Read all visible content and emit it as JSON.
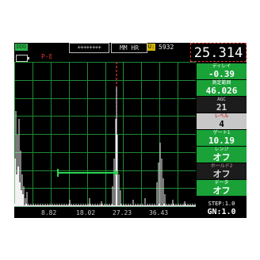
{
  "status_bar": {
    "channel_badge": "DDD",
    "crosses": "++++++++",
    "mode": "MM HR",
    "u_label": "U:",
    "u_value": "5932",
    "reading": "25.314"
  },
  "indicator": {
    "pe_label": "P-E"
  },
  "params": [
    {
      "label": "ディレイ",
      "value": "-0.39",
      "style": "green"
    },
    {
      "label": "測定範囲",
      "value": "46.026",
      "style": "green"
    },
    {
      "label": "AGC",
      "value": "21",
      "style": "dark"
    },
    {
      "label": "レベル",
      "value": "4",
      "style": "grey"
    },
    {
      "label": "ゲート1",
      "value": "10.19",
      "style": "green"
    },
    {
      "label": "レンジ",
      "value": "オフ",
      "style": "green"
    },
    {
      "label": "ホールド2",
      "value": "オフ",
      "style": "dark"
    },
    {
      "label": "データ",
      "value": "オフ",
      "style": "green"
    }
  ],
  "step": {
    "line1": "STEP:1.0",
    "line2": "GN:1.0"
  },
  "x_ticks": [
    "8.82",
    "18.02",
    "27.23",
    "36.43"
  ],
  "colors": {
    "grid": "#1f8a32",
    "trace": "#f2f2f2",
    "gate": "#2bd552",
    "cursor": "#e53935"
  }
}
